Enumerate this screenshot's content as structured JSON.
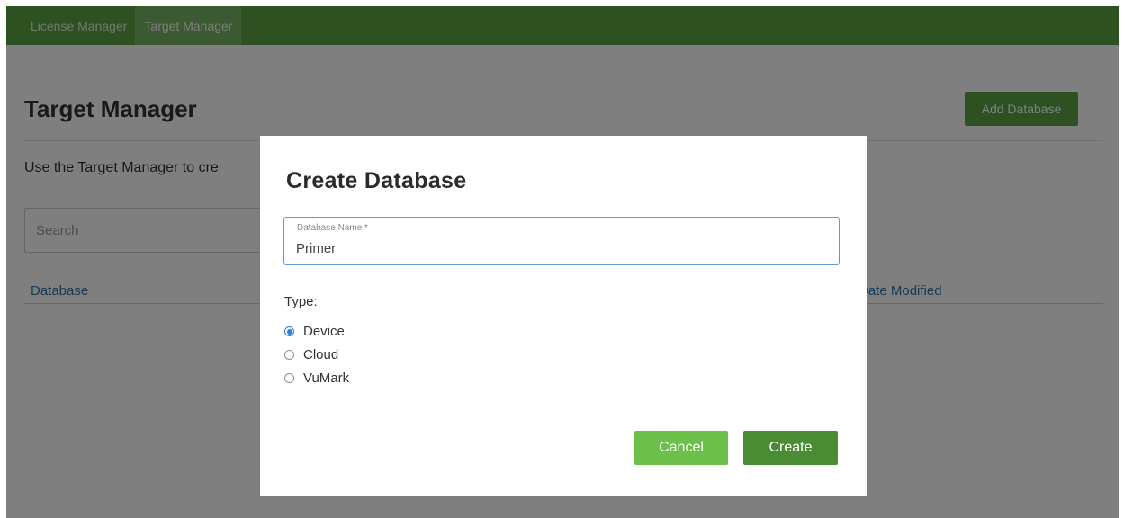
{
  "nav": {
    "tabs": [
      {
        "label": "License Manager",
        "active": false
      },
      {
        "label": "Target Manager",
        "active": true
      }
    ]
  },
  "header": {
    "title": "Target Manager",
    "add_button_label": "Add Database"
  },
  "intro": {
    "text": "Use the Target Manager to cre"
  },
  "search": {
    "placeholder": "Search"
  },
  "table": {
    "columns": [
      "Database",
      "Date Modified"
    ]
  },
  "modal": {
    "title": "Create Database",
    "name_field": {
      "label": "Database Name *",
      "value": "Primer"
    },
    "type_label": "Type:",
    "type_options": [
      {
        "label": "Device",
        "selected": true
      },
      {
        "label": "Cloud",
        "selected": false
      },
      {
        "label": "VuMark",
        "selected": false
      }
    ],
    "cancel_label": "Cancel",
    "create_label": "Create"
  },
  "colors": {
    "nav_green": "#5aa341",
    "primary_green": "#4a8c34",
    "cancel_green": "#6cc04a",
    "link_blue": "#2f74a8",
    "focus_blue": "#5b9bd5",
    "radio_blue": "#2d7fd8"
  }
}
